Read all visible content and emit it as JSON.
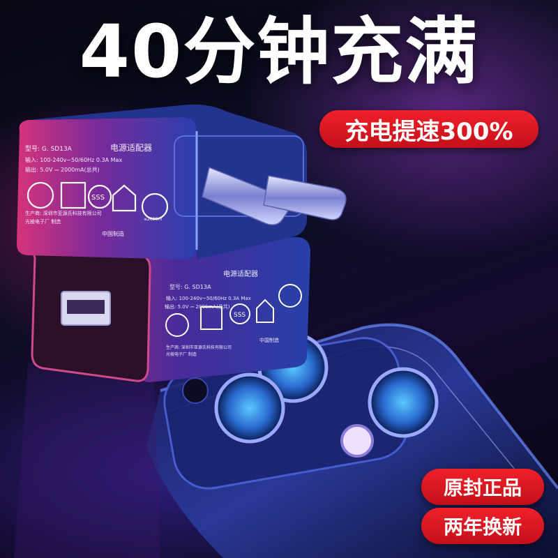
{
  "headline": "40分钟充满",
  "badges": {
    "speed": "充电提速300%",
    "genuine": "原封正品",
    "warranty": "两年换新"
  },
  "product_label": {
    "model": "型号: G. SD13A",
    "type": "电源适配器",
    "input": "输入: 100-240v~50/60Hz 0.3A Max",
    "output": "输出: 5.0V ⎓ 2000mA(总共)",
    "manufacturer": "生产商: 深圳市亚源氏科技有限公司",
    "factory": "光棱电子厂 制造",
    "origin": "中国制造",
    "altitude": "≤2000m",
    "mark": "SSS"
  },
  "colors": {
    "badge_red": "#e8161f",
    "headline": "#ffffff"
  }
}
